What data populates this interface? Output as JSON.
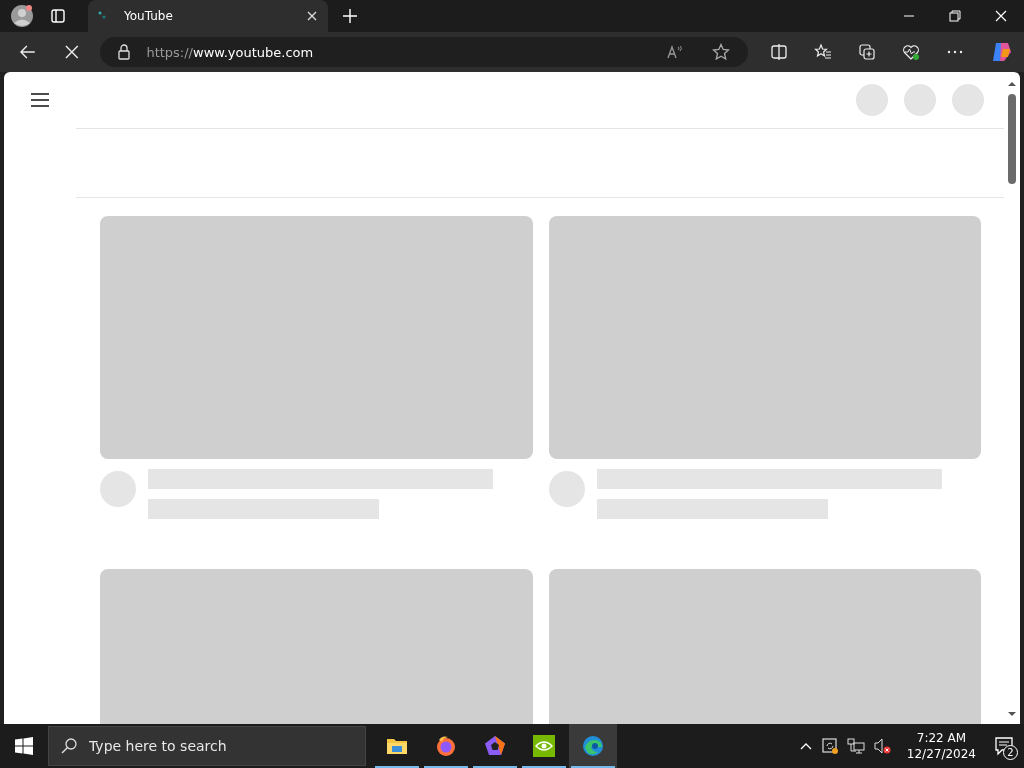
{
  "browser": {
    "tab": {
      "title": "YouTube",
      "selected": true
    },
    "address": {
      "scheme": "https://",
      "host": "www.youtube.com"
    }
  },
  "page": {
    "header_placeholders": [
      {
        "kind": "circle"
      },
      {
        "kind": "circle"
      },
      {
        "kind": "circle"
      }
    ],
    "video_placeholders": [
      {
        "kind": "skeleton"
      },
      {
        "kind": "skeleton"
      },
      {
        "kind": "thumbnail"
      },
      {
        "kind": "thumbnail"
      }
    ]
  },
  "taskbar": {
    "search": {
      "placeholder": "Type here to search"
    },
    "apps": [
      {
        "kind": "folder",
        "selected": false
      },
      {
        "kind": "firefox",
        "selected": false
      },
      {
        "kind": "pentagon",
        "selected": false
      },
      {
        "kind": "nvidia",
        "selected": false
      },
      {
        "kind": "edge",
        "selected": true
      }
    ],
    "clock": {
      "time": "7:22 AM",
      "date": "12/27/2024"
    },
    "notifications": {
      "count": "2"
    }
  }
}
